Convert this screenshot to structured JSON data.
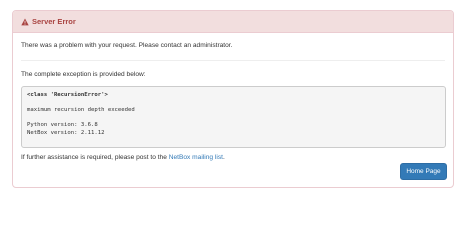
{
  "panel": {
    "heading": "Server Error",
    "icon": "warning-icon",
    "colors": {
      "heading_text": "#a94442",
      "heading_bg": "#f2dede",
      "link": "#337ab7",
      "button_bg": "#337ab7"
    }
  },
  "body": {
    "problem_text": "There was a problem with your request. Please contact an administrator.",
    "exception_intro": "The complete exception is provided below:",
    "exception": {
      "class_line": "<class 'RecursionError'>",
      "message": "maximum recursion depth exceeded",
      "python_version": "Python version: 3.6.8",
      "netbox_version": "NetBox version: 2.11.12"
    },
    "assistance_prefix": "If further assistance is required, please post to the ",
    "mailing_list_link": "NetBox mailing list",
    "assistance_suffix": "."
  },
  "footer": {
    "home_button": "Home Page"
  }
}
